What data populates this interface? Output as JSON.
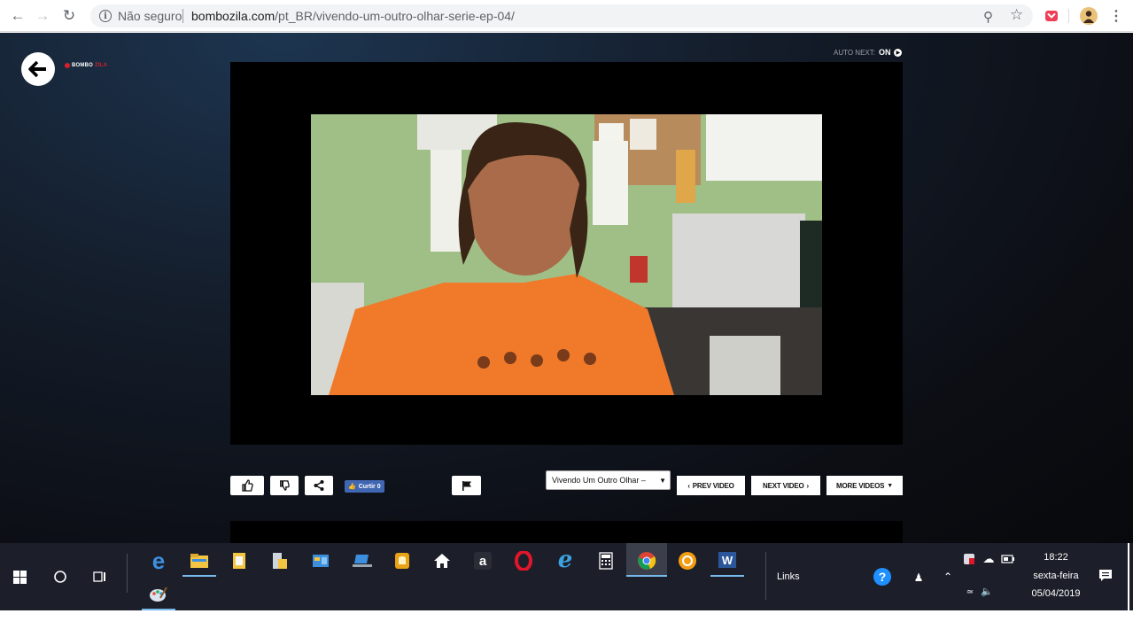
{
  "browser": {
    "security_label": "Não seguro",
    "url_host": "bombozila.com",
    "url_path": "/pt_BR/vivendo-um-outro-olhar-serie-ep-04/"
  },
  "page": {
    "logo_text_a": "BOMBO",
    "logo_text_b": "ZILA",
    "autonext_label": "AUTO NEXT:",
    "autonext_state": "ON",
    "fb_like_label": "Curtir 0",
    "video_select_value": "Vivendo Um Outro Olhar –",
    "prev_label": "PREV VIDEO",
    "next_label": "NEXT VIDEO",
    "more_label": "MORE VIDEOS"
  },
  "taskbar": {
    "links_label": "Links",
    "time": "18:22",
    "weekday": "sexta-feira",
    "date": "05/04/2019"
  },
  "colors": {
    "accent_red": "#d6202e",
    "facebook_blue": "#4267b2",
    "taskbar_bg": "#1c1f29"
  }
}
